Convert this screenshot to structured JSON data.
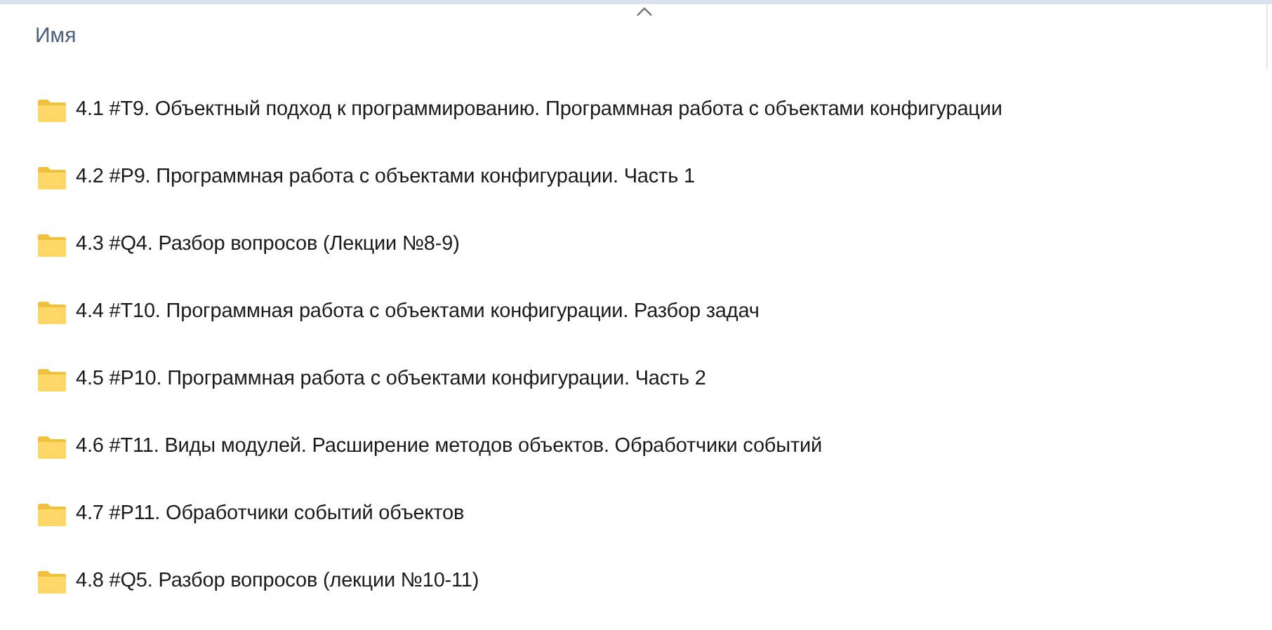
{
  "column_header": {
    "label": "Имя"
  },
  "items": [
    {
      "name": "4.1 #T9. Объектный подход к программированию. Программная работа с объектами конфигурации"
    },
    {
      "name": "4.2 #P9. Программная работа с объектами конфигурации. Часть 1"
    },
    {
      "name": "4.3 #Q4. Разбор вопросов (Лекции №8-9)"
    },
    {
      "name": "4.4 #T10. Программная работа с объектами конфигурации. Разбор задач"
    },
    {
      "name": "4.5 #P10. Программная работа с объектами конфигурации. Часть 2"
    },
    {
      "name": "4.6 #T11. Виды модулей. Расширение методов объектов. Обработчики событий"
    },
    {
      "name": "4.7 #P11. Обработчики событий объектов"
    },
    {
      "name": "4.8 #Q5. Разбор вопросов (лекции №10-11)"
    }
  ]
}
